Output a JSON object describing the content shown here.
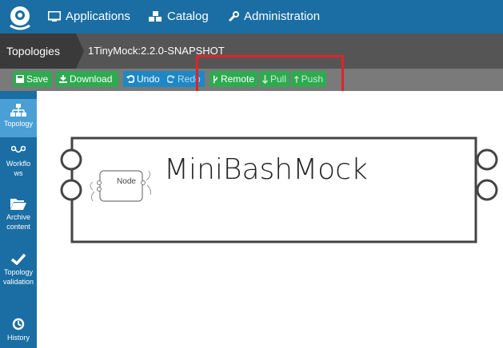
{
  "nav": {
    "applications": "Applications",
    "catalog": "Catalog",
    "administration": "Administration"
  },
  "breadcrumb": {
    "first": "Topologies",
    "second": "1TinyMock:2.2.0-SNAPSHOT"
  },
  "toolbar": {
    "save": "Save",
    "download": "Download",
    "undo": "Undo",
    "redo": "Redo",
    "remote": "Remote",
    "pull": "Pull",
    "push": "Push"
  },
  "sidebar": {
    "items": [
      {
        "label": "Topology",
        "icon": "sitemap-icon"
      },
      {
        "label": "Workflows",
        "icon": "workflow-icon"
      },
      {
        "label": "Archive content",
        "icon": "folder-open-icon"
      },
      {
        "label": "Topology validation",
        "icon": "check-icon"
      },
      {
        "label": "History",
        "icon": "history-icon"
      }
    ]
  },
  "topology": {
    "title": "MiniBashMock",
    "node_label": "Node"
  },
  "colors": {
    "nav_bg": "#1a6ea3",
    "green": "#2eaa50",
    "blue": "#1d88c6",
    "highlight": "#e0232a"
  }
}
